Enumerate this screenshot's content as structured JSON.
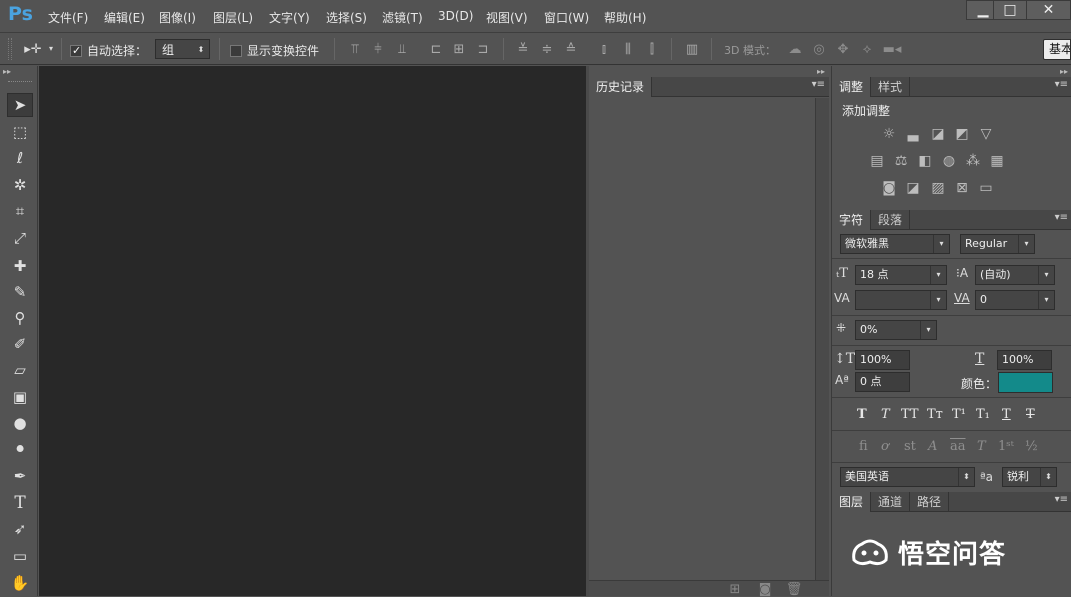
{
  "app": {
    "logo": "Ps"
  },
  "menu": [
    "文件(F)",
    "编辑(E)",
    "图像(I)",
    "图层(L)",
    "文字(Y)",
    "选择(S)",
    "滤镜(T)",
    "3D(D)",
    "视图(V)",
    "窗口(W)",
    "帮助(H)"
  ],
  "window_controls": {
    "minimize": "▁",
    "maximize": "□",
    "close": "✕"
  },
  "options": {
    "auto_select_label": "自动选择：",
    "auto_select_checked": true,
    "group_value": "组",
    "show_transform_label": "显示变换控件",
    "mode3d_label": "3D 模式：",
    "workspace_button": "基本"
  },
  "history_panel": {
    "tab": "历史记录"
  },
  "adjust_panel": {
    "tabs": [
      "调整",
      "样式"
    ],
    "title": "添加调整"
  },
  "char_panel": {
    "tabs": [
      "字符",
      "段落"
    ],
    "font_family": "微软雅黑",
    "font_style": "Regular",
    "font_size": "18 点",
    "leading": "(自动)",
    "kerning": "",
    "tracking": "0",
    "scale_tsume": "0%",
    "vscale": "100%",
    "hscale": "100%",
    "baseline": "0 点",
    "color_label": "颜色：",
    "color_hex": "#138a8a",
    "language": "美国英语",
    "aa_icon": "ªa",
    "antialias": "锐利"
  },
  "layers_panel": {
    "tabs": [
      "图层",
      "通道",
      "路径"
    ]
  },
  "watermark": {
    "text": "悟空问答"
  }
}
